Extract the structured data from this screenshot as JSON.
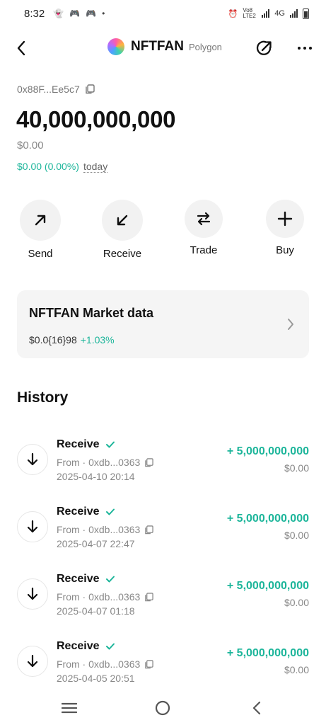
{
  "status_bar": {
    "time": "8:32",
    "network_label": "Vo8 LTE2",
    "network_type": "4G"
  },
  "header": {
    "token_name": "NFTFAN",
    "chain": "Polygon"
  },
  "wallet": {
    "address": "0x88F...Ee5c7",
    "balance": "40,000,000,000",
    "fiat_value": "$0.00",
    "change": "$0.00 (0.00%)",
    "change_period": "today"
  },
  "actions": [
    {
      "label": "Send",
      "icon": "arrow-up-right-icon"
    },
    {
      "label": "Receive",
      "icon": "arrow-down-left-icon"
    },
    {
      "label": "Trade",
      "icon": "swap-arrows-icon"
    },
    {
      "label": "Buy",
      "icon": "plus-icon"
    }
  ],
  "market": {
    "title": "NFTFAN Market data",
    "price": "$0.0{16}98",
    "change": "+1.03%"
  },
  "history": {
    "title": "History",
    "items": [
      {
        "type": "Receive",
        "from": "From · 0xdb...0363",
        "time": "2025-04-10 20:14",
        "amount": "+ 5,000,000,000",
        "fiat": "$0.00"
      },
      {
        "type": "Receive",
        "from": "From · 0xdb...0363",
        "time": "2025-04-07 22:47",
        "amount": "+ 5,000,000,000",
        "fiat": "$0.00"
      },
      {
        "type": "Receive",
        "from": "From · 0xdb...0363",
        "time": "2025-04-07 01:18",
        "amount": "+ 5,000,000,000",
        "fiat": "$0.00"
      },
      {
        "type": "Receive",
        "from": "From · 0xdb...0363",
        "time": "2025-04-05 20:51",
        "amount": "+ 5,000,000,000",
        "fiat": "$0.00"
      }
    ]
  },
  "colors": {
    "accent": "#1cb59a",
    "muted": "#888888",
    "card_bg": "#f5f5f5"
  }
}
